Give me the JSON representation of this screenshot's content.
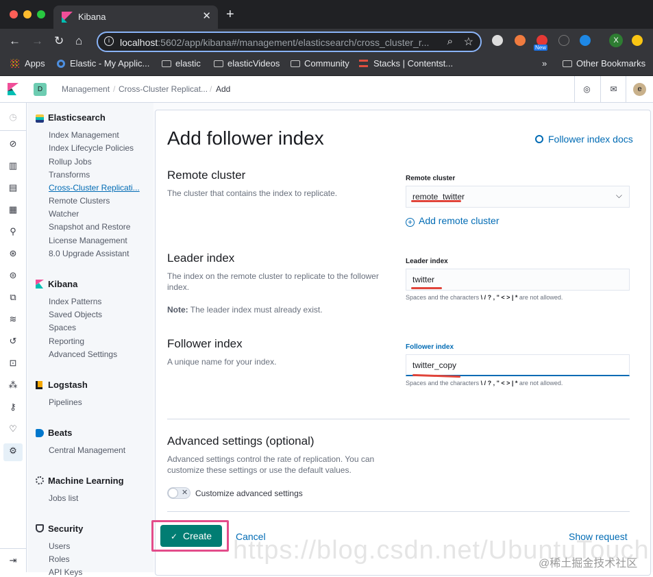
{
  "browser": {
    "tab_title": "Kibana",
    "url_host": "localhost",
    "url_rest": ":5602/app/kibana#/management/elasticsearch/cross_cluster_r...",
    "new_badge": "New",
    "profile_initial": "X",
    "bookmarks": {
      "apps": "Apps",
      "elastic_app": "Elastic - My Applic...",
      "elastic": "elastic",
      "elastic_videos": "elasticVideos",
      "community": "Community",
      "stacks": "Stacks | Contentst...",
      "more": "»",
      "other": "Other Bookmarks"
    }
  },
  "kibana_header": {
    "space_initial": "D",
    "breadcrumbs": [
      "Management",
      "Cross-Cluster Replicat...",
      "Add"
    ],
    "user_initial": "e"
  },
  "sidebar": {
    "elasticsearch": {
      "title": "Elasticsearch",
      "items": [
        "Index Management",
        "Index Lifecycle Policies",
        "Rollup Jobs",
        "Transforms",
        "Cross-Cluster Replicati...",
        "Remote Clusters",
        "Watcher",
        "Snapshot and Restore",
        "License Management",
        "8.0 Upgrade Assistant"
      ]
    },
    "kibana": {
      "title": "Kibana",
      "items": [
        "Index Patterns",
        "Saved Objects",
        "Spaces",
        "Reporting",
        "Advanced Settings"
      ]
    },
    "logstash": {
      "title": "Logstash",
      "items": [
        "Pipelines"
      ]
    },
    "beats": {
      "title": "Beats",
      "items": [
        "Central Management"
      ]
    },
    "ml": {
      "title": "Machine Learning",
      "items": [
        "Jobs list"
      ]
    },
    "security": {
      "title": "Security",
      "items": [
        "Users",
        "Roles",
        "API Keys"
      ]
    }
  },
  "form": {
    "title": "Add follower index",
    "docs_link": "Follower index docs",
    "remote_cluster": {
      "heading": "Remote cluster",
      "description": "The cluster that contains the index to replicate.",
      "label": "Remote cluster",
      "value": "remote_twitter",
      "add_link": "Add remote cluster"
    },
    "leader_index": {
      "heading": "Leader index",
      "description": "The index on the remote cluster to replicate to the follower index.",
      "note_label": "Note:",
      "note": " The leader index must already exist.",
      "label": "Leader index",
      "value": "twitter",
      "help_pre": "Spaces and the characters ",
      "help_chars": "\\ / ? , \" < > | *",
      "help_post": " are not allowed."
    },
    "follower_index": {
      "heading": "Follower index",
      "description": "A unique name for your index.",
      "label": "Follower index",
      "value": "twitter_copy",
      "help_pre": "Spaces and the characters ",
      "help_chars": "\\ / ? , \" < > | *",
      "help_post": " are not allowed."
    },
    "advanced": {
      "heading": "Advanced settings (optional)",
      "description": "Advanced settings control the rate of replication. You can customize these settings or use the default values.",
      "toggle_label": "Customize advanced settings"
    },
    "create_label": "Create",
    "cancel_label": "Cancel",
    "show_request_label": "Show request"
  },
  "overlay": {
    "watermark": "@稀土掘金技术社区",
    "ghost_url": "https://blog.csdn.net/UbuntuTouch"
  },
  "colors": {
    "accent": "#006bb4",
    "primary_button": "#017d73",
    "highlight_frame": "#e34c8a",
    "annotation": "#e0443a"
  }
}
